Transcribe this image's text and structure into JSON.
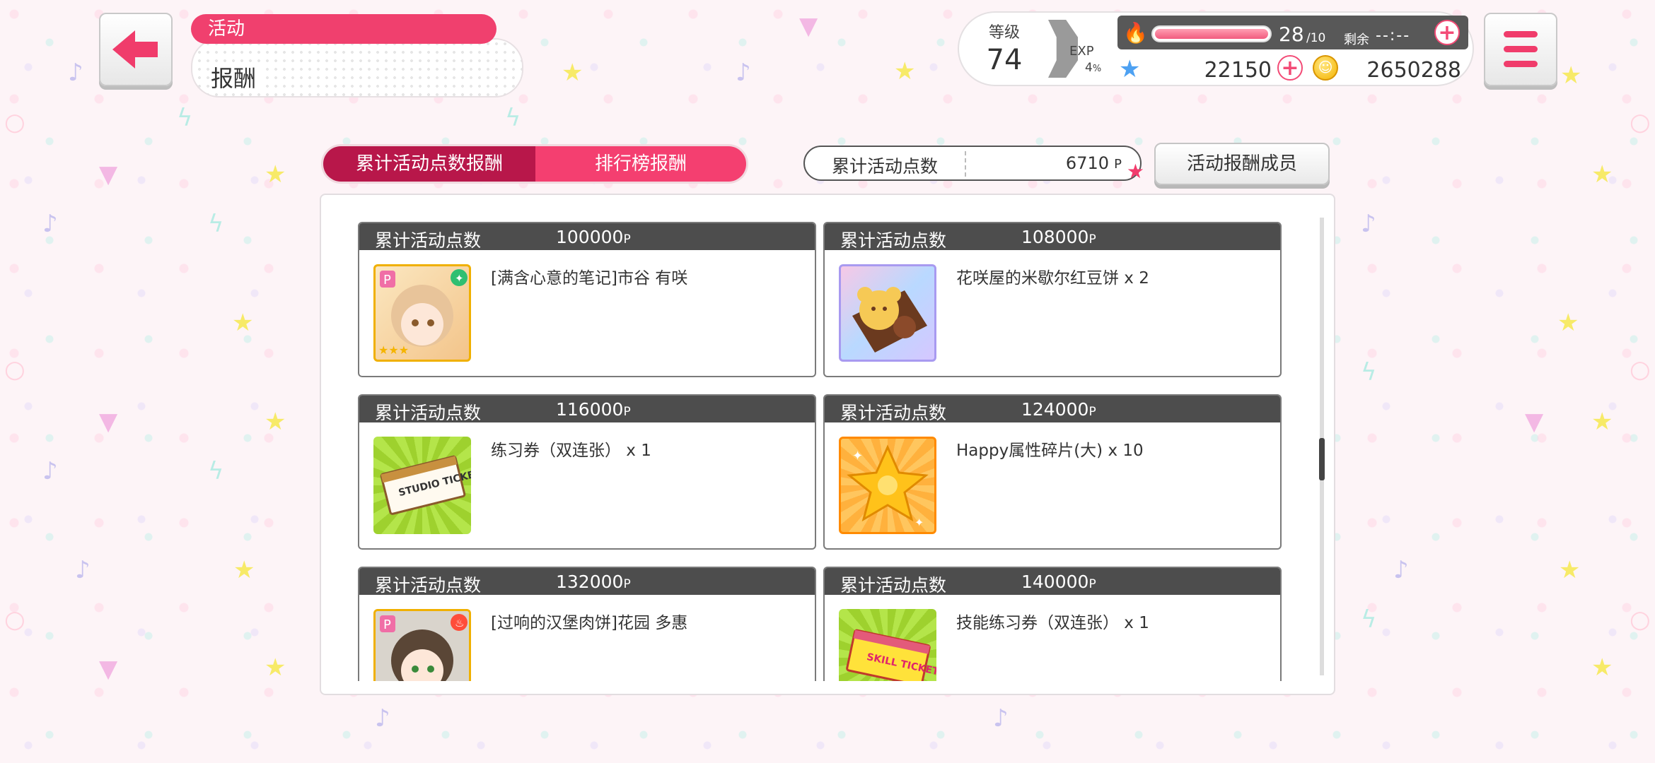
{
  "header": {
    "category": "活动",
    "title": "报酬"
  },
  "status": {
    "level_label": "等级",
    "level": "74",
    "exp_label": "EXP",
    "exp_percent": "4",
    "exp_percent_unit": "%",
    "stamina": "28",
    "stamina_max": "/10",
    "remaining_label": "剩余",
    "remaining_time": "--:--",
    "stars": "22150",
    "coins": "2650288",
    "colors": {
      "accent": "#f03c6b",
      "stamina_bar": "#f25b7e"
    }
  },
  "tabs": [
    {
      "label": "累计活动点数报酬",
      "selected": true
    },
    {
      "label": "排行榜报酬",
      "selected": false
    }
  ],
  "points": {
    "label": "累计活动点数",
    "value": "6710",
    "unit": "P"
  },
  "members_button": "活动报酬成员",
  "rewards": [
    {
      "label": "累计活动点数",
      "points": "100000",
      "unit": "P",
      "item": "[满含心意的笔记]市谷 有咲",
      "icon": "member-card-icon"
    },
    {
      "label": "累计活动点数",
      "points": "108000",
      "unit": "P",
      "item": "花咲屋的米歇尔红豆饼 x 2",
      "icon": "bear-cookie-icon"
    },
    {
      "label": "累计活动点数",
      "points": "116000",
      "unit": "P",
      "item": "练习券（双连张） x 1",
      "icon": "studio-ticket-icon"
    },
    {
      "label": "累计活动点数",
      "points": "124000",
      "unit": "P",
      "item": "Happy属性碎片(大) x 10",
      "icon": "happy-shard-icon"
    },
    {
      "label": "累计活动点数",
      "points": "132000",
      "unit": "P",
      "item": "[过响的汉堡肉饼]花园 多惠",
      "icon": "member-card-icon"
    },
    {
      "label": "累计活动点数",
      "points": "140000",
      "unit": "P",
      "item": "技能练习券（双连张） x 1",
      "icon": "skill-ticket-icon"
    }
  ],
  "ticket_texts": {
    "studio": "STUDIO TICKET",
    "skill": "SKILL TICKET"
  }
}
